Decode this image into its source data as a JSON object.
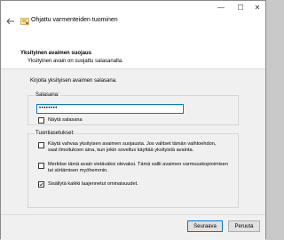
{
  "window": {
    "title": "Ohjattu varmenteiden tuominen",
    "controls": {
      "minimize": "—",
      "maximize": "☐",
      "close": "✕"
    }
  },
  "header": {
    "title": "Yksityinen avaimen suojaus",
    "subtitle": "Yksityinen avain on suojattu salasanalla."
  },
  "body": {
    "prompt": "Kirjoita yksityisen avaimen salasana.",
    "password_group_label": "Salasana:",
    "password_value": "••••••••",
    "show_password_label": "Näytä salasana",
    "import_group_label": "Tuontiasetukset:",
    "options": [
      {
        "line1": "Käytä vahvaa yksityisen avaimen suojausta. Jos valitset tämän vaihtoehdon,",
        "line2": "saat ilmoituksen aina, kun jokin sovellus käyttää yksityistä avainta.",
        "checked": false
      },
      {
        "line1": "Merkitse tämä avain vietäväksi olevaksi. Tämä sallii avaimen varmuuskopioimisen",
        "line2": "tai siirtämisen myöhemmin.",
        "checked": false
      },
      {
        "line1": "Sisällytä kaikki laajennetut ominaisuudet.",
        "line2": "",
        "checked": true
      }
    ]
  },
  "footer": {
    "next_label": "Seuraava",
    "cancel_label": "Peruuta"
  },
  "colors": {
    "accent": "#0078d7",
    "background": "#f0f0f0"
  },
  "icons": {
    "back": "back-arrow-icon",
    "wizard": "certificate-wizard-icon",
    "check": "checkmark-icon"
  }
}
